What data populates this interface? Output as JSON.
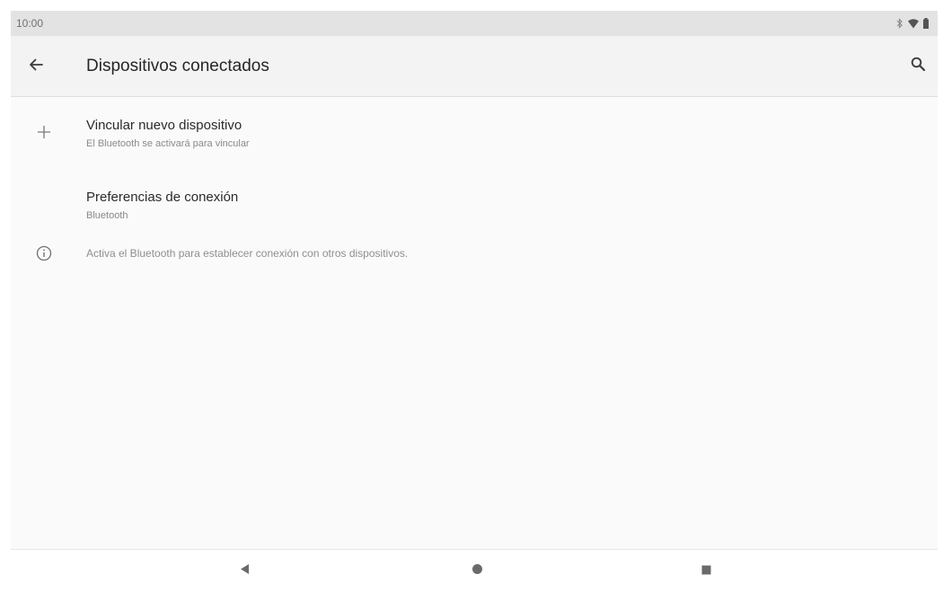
{
  "status_bar": {
    "time": "10:00"
  },
  "app_bar": {
    "title": "Dispositivos conectados"
  },
  "items": [
    {
      "title": "Vincular nuevo dispositivo",
      "subtitle": "El Bluetooth se activará para vincular"
    },
    {
      "title": "Preferencias de conexión",
      "subtitle": "Bluetooth"
    }
  ],
  "info": {
    "text": "Activa el Bluetooth para establecer conexión con otros dispositivos."
  },
  "colors": {
    "icon": "#616161",
    "status_bar": "#e3e3e3",
    "app_bar": "#f3f3f3",
    "background": "#fafafa"
  }
}
